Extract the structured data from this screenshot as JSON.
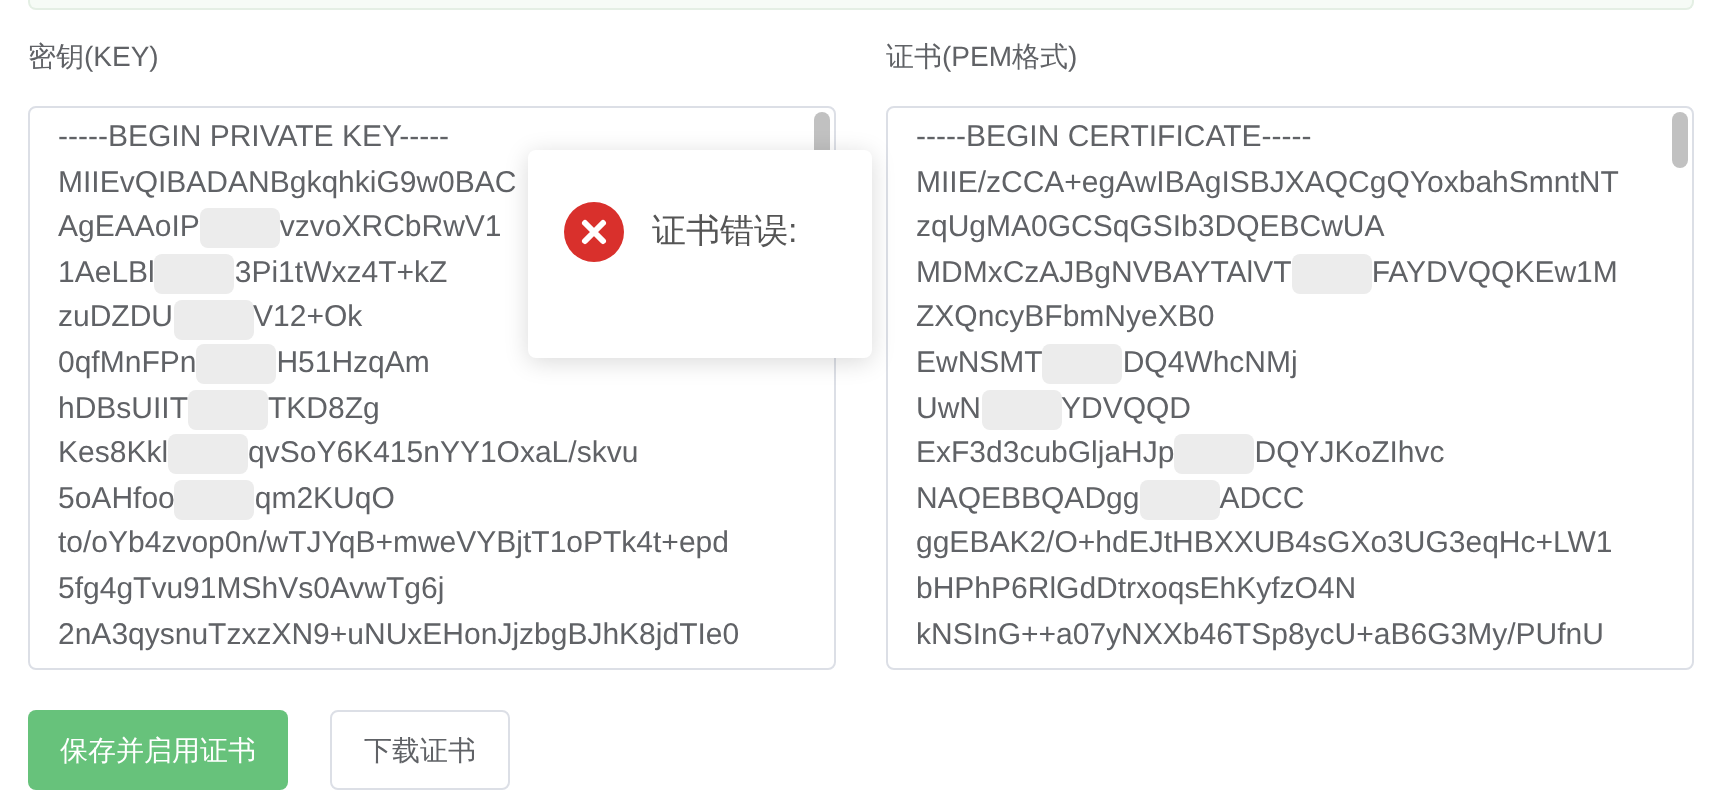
{
  "key_field": {
    "label": "密钥(KEY)",
    "lines": [
      [
        "-----BEGIN PRIVATE KEY-----"
      ],
      [
        "MIIEvQIBADANBgkqhkiG9w0BAC"
      ],
      [
        "AgEAAoIP",
        "vzvoXRCbRwV1"
      ],
      [
        "1AeLBl",
        "3Pi1tWxz4T+kZ"
      ],
      [
        "zuDZDU",
        "V12+Ok"
      ],
      [
        "0qfMnFPn",
        "H51HzqAm"
      ],
      [
        "hDBsUIIT",
        "TKD8Zg"
      ],
      [
        "Kes8Kkl",
        "qvSoY6K415nYY1OxaL/skvu"
      ],
      [
        "5oAHfoo",
        "qm2KUqO"
      ],
      [
        "to/oYb4zvop0n/wTJYqB+mweVYBjtT1oPTk4t+epd"
      ],
      [
        "5fg4gTvu91MShVs0AvwTg6j"
      ],
      [
        "2nA3qysnuTzxzXN9+uNUxEHonJjzbgBJhK8jdTIe0"
      ]
    ]
  },
  "cert_field": {
    "label": "证书(PEM格式)",
    "lines": [
      [
        "-----BEGIN CERTIFICATE-----"
      ],
      [
        "MIIE/zCCA+egAwIBAgISBJXAQCgQYoxbahSmntNT"
      ],
      [
        "zqUgMA0GCSqGSIb3DQEBCwUA"
      ],
      [
        "MDMxCzAJBgNVBAYTAlVT",
        "FAYDVQQKEw1M"
      ],
      [
        "ZXQncyBFbmNyeXB0"
      ],
      [
        "EwNSMT",
        "DQ4WhcNMj"
      ],
      [
        "UwN",
        "YDVQQD"
      ],
      [
        "ExF3d3cubGljaHJp",
        "DQYJKoZIhvc"
      ],
      [
        "NAQEBBQADgg",
        "ADCC"
      ],
      [
        "ggEBAK2/O+hdEJtHBXXUB4sGXo3UG3eqHc+LW1"
      ],
      [
        "bHPhP6RlGdDtrxoqsEhKyfzO4N"
      ],
      [
        "kNSInG++a07yNXXb46TSp8ycU+aB6G3My/PUfnU"
      ]
    ]
  },
  "buttons": [
    {
      "label": "保存并启用证书",
      "kind": "primary"
    },
    {
      "label": "下载证书",
      "kind": "default"
    }
  ],
  "toast": {
    "kind": "error",
    "message": "证书错误:"
  }
}
